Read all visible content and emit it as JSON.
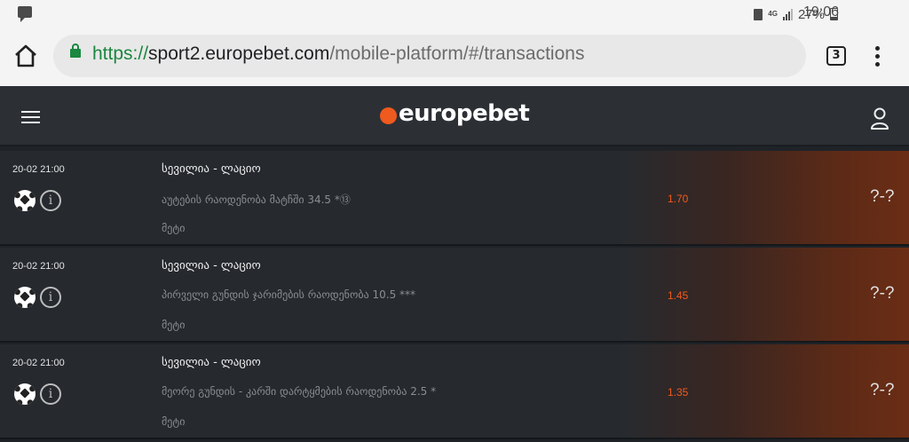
{
  "status_bar": {
    "network": "4G",
    "battery_percent": "27%",
    "time": "19:06",
    "icons": [
      "message-icon",
      "sim-icon",
      "signal-icon",
      "battery-icon"
    ]
  },
  "browser": {
    "url_scheme": "https://",
    "url_host": "sport2.europebet.com",
    "url_path": "/mobile-platform/#/transactions",
    "tab_count": "3",
    "secure_color": "#1b873f"
  },
  "header": {
    "logo_text": "europebet",
    "accent_color": "#ef5a1e"
  },
  "bets": [
    {
      "date": "20-02 21:00",
      "match": "სევილია - ლაციო",
      "market": "აუტების რაოდენობა მატჩში 34.5 *⑬",
      "more": "მეტი",
      "odds": "1.70",
      "score": "?-?",
      "sport_icon": "soccer-ball-icon"
    },
    {
      "date": "20-02 21:00",
      "match": "სევილია - ლაციო",
      "market": "პირველი გუნდის ჯარიმების რაოდენობა 10.5 ***",
      "more": "მეტი",
      "odds": "1.45",
      "score": "?-?",
      "sport_icon": "soccer-ball-icon"
    },
    {
      "date": "20-02 21:00",
      "match": "სევილია - ლაციო",
      "market": "მეორე გუნდის - კარში დარტყმების რაოდენობა 2.5  *",
      "more": "მეტი",
      "odds": "1.35",
      "score": "?-?",
      "sport_icon": "soccer-ball-icon"
    }
  ]
}
